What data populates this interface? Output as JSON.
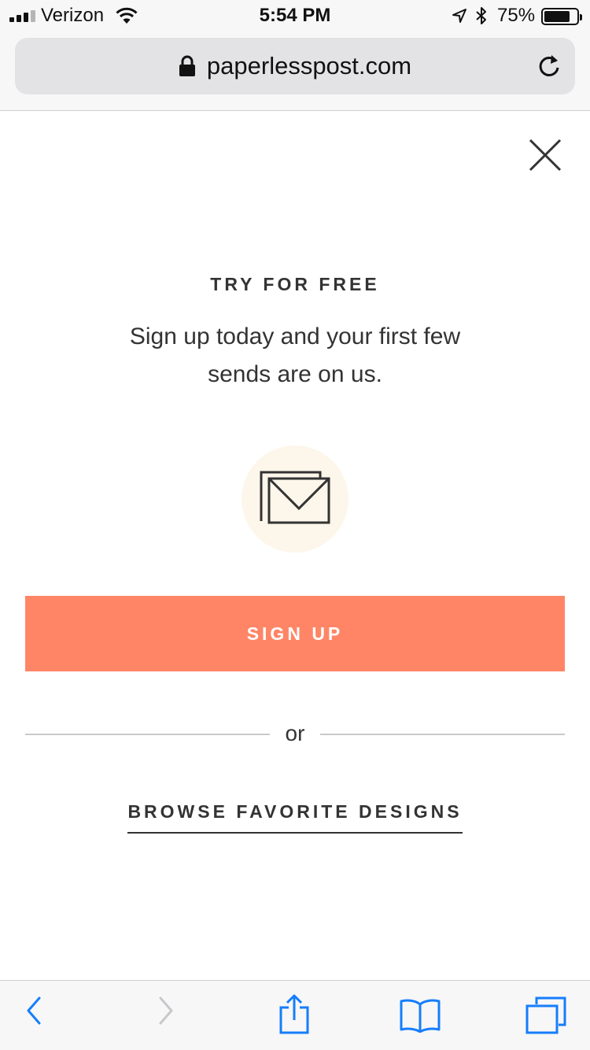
{
  "status_bar": {
    "carrier": "Verizon",
    "time": "5:54 PM",
    "battery_percent": "75%",
    "battery_level": 0.75,
    "icons": [
      "signal-icon",
      "wifi-icon",
      "location-icon",
      "bluetooth-icon",
      "battery-icon"
    ]
  },
  "browser": {
    "url": "paperlesspost.com",
    "icons": [
      "lock-icon",
      "reload-icon"
    ]
  },
  "modal": {
    "heading": "TRY FOR FREE",
    "subtext": "Sign up today and your first few sends are on us.",
    "icon": "envelopes-icon",
    "signup_label": "SIGN UP",
    "or_label": "or",
    "browse_label": "BROWSE FAVORITE DESIGNS",
    "close_icon": "close-icon"
  },
  "toolbar": {
    "icons": [
      "back-icon",
      "forward-icon",
      "share-icon",
      "bookmarks-icon",
      "tabs-icon"
    ]
  },
  "colors": {
    "accent": "#ff8566",
    "envelope_circle": "#fdf6ea",
    "ios_blue": "#157efb",
    "text": "#333333"
  }
}
